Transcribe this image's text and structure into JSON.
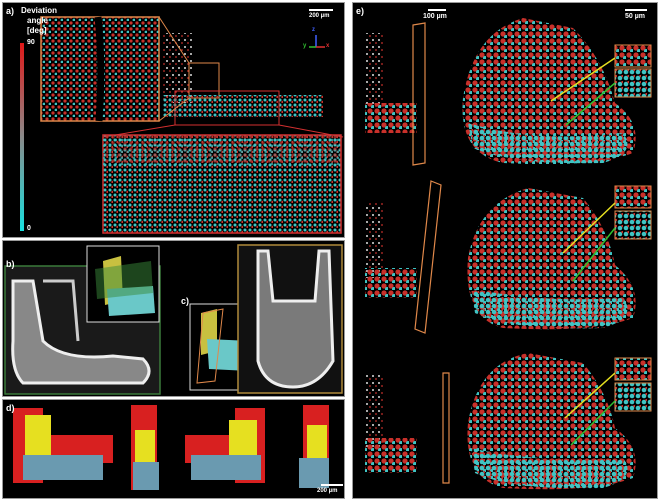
{
  "panel_a": {
    "label": "a)",
    "legend_title_line1": "Deviation",
    "legend_title_line2": "angle",
    "legend_unit": "[deg]",
    "legend_max": "90",
    "legend_min": "0",
    "scale": "200 µm",
    "axes": {
      "z": "z",
      "y": "y",
      "x": "x"
    }
  },
  "panel_b": {
    "label": "b)"
  },
  "panel_c": {
    "label": "c)"
  },
  "panel_d": {
    "label": "d)",
    "scale": "200 µm"
  },
  "panel_e": {
    "label": "e)",
    "scale_left": "100 µm",
    "scale_right": "50 µm"
  },
  "colors": {
    "cyan": "#3fc4c4",
    "red": "#c8302a",
    "yellow": "#e6e020",
    "orange": "#e0884a",
    "green": "#3a7a3a",
    "olive": "#b08a3a"
  }
}
